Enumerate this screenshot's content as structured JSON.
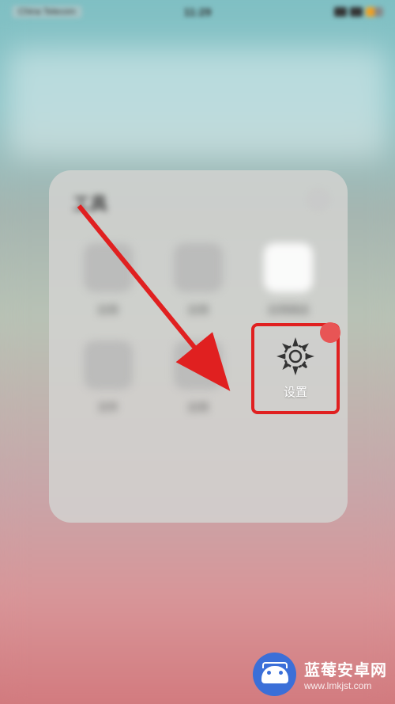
{
  "status_bar": {
    "carrier": "China Telecom",
    "time": "11:29"
  },
  "folder": {
    "title": "工具",
    "icons": [
      {
        "label": "应用"
      },
      {
        "label": "应用"
      },
      {
        "label": "应用商店"
      },
      {
        "label": "文件"
      },
      {
        "label": "应用"
      }
    ]
  },
  "settings": {
    "label": "设置",
    "icon_name": "gear-icon"
  },
  "watermark": {
    "title": "蓝莓安卓网",
    "url": "www.lmkjst.com"
  },
  "colors": {
    "highlight_border": "#e02020",
    "arrow": "#e02020",
    "watermark_bg": "#3b6fd8"
  }
}
